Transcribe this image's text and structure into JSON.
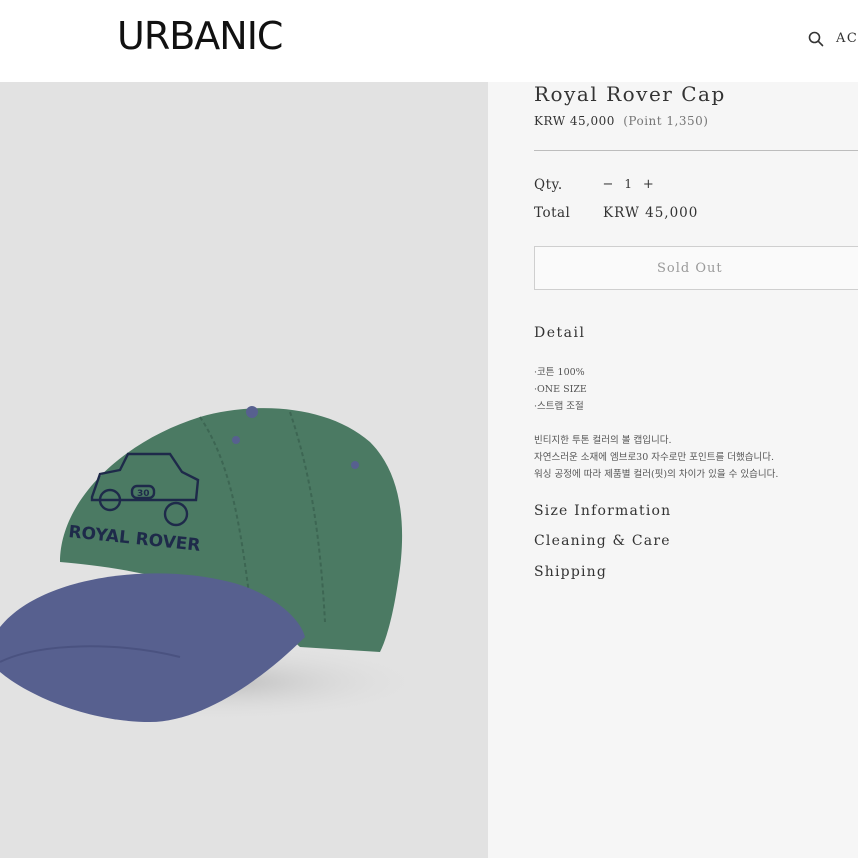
{
  "header": {
    "logo": "URBANIC",
    "account_label": "ACC"
  },
  "product": {
    "title": "Royal Rover Cap",
    "price": "KRW 45,000",
    "points": "(Point 1,350)",
    "qty_label": "Qty.",
    "qty_minus": "−",
    "qty_value": "1",
    "qty_plus": "+",
    "total_label": "Total",
    "total_value": "KRW 45,000",
    "soldout_label": "Sold Out",
    "image_embroidery": "ROYAL ROVER",
    "image_badge": "30"
  },
  "detail": {
    "heading": "Detail",
    "items": [
      "·코튼 100%",
      "·ONE SIZE",
      "·스트랩 조절"
    ],
    "desc": [
      "빈티지한 투톤 컬러의 볼 캡입니다.",
      "자연스러운 소재에 엠브로30 자수로만 포인트를 더했습니다.",
      "워싱 공정에 따라 제품별 컬러(핏)의 차이가 있을 수 있습니다."
    ]
  },
  "accordions": {
    "size": "Size Information",
    "care": "Cleaning & Care",
    "shipping": "Shipping"
  },
  "colors": {
    "cap_crown": "#4b7a63",
    "cap_brim": "#57608f",
    "embroidery": "#1e2a4a",
    "image_bg": "#e2e2e2"
  }
}
